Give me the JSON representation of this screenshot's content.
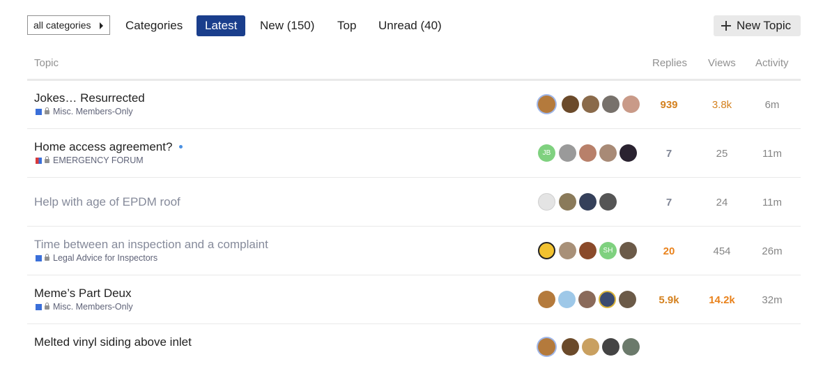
{
  "nav": {
    "category_dropdown": "all categories",
    "links": [
      "Categories",
      "Latest",
      "New (150)",
      "Top",
      "Unread (40)"
    ],
    "active": "Latest",
    "new_topic": "New Topic"
  },
  "columns": {
    "topic": "Topic",
    "replies": "Replies",
    "views": "Views",
    "activity": "Activity"
  },
  "colors": {
    "accent": "#1a3e8c",
    "hot": "#e07b20",
    "muted": "#858a9a"
  },
  "topics": [
    {
      "title": "Jokes… Resurrected",
      "category": "Misc. Members-Only",
      "replies": "939",
      "views": "3.8k",
      "activity": "6m"
    },
    {
      "title": "Home access agreement?",
      "category": "EMERGENCY FORUM",
      "replies": "7",
      "views": "25",
      "activity": "11m",
      "avatar_initials": "JB"
    },
    {
      "title": "Help with age of EPDM roof",
      "category": "",
      "replies": "7",
      "views": "24",
      "activity": "11m"
    },
    {
      "title": "Time between an inspection and a complaint",
      "category": "Legal Advice for Inspectors",
      "replies": "20",
      "views": "454",
      "activity": "26m",
      "avatar_initials": "SH"
    },
    {
      "title": "Meme’s Part Deux",
      "category": "Misc. Members-Only",
      "replies": "5.9k",
      "views": "14.2k",
      "activity": "32m"
    },
    {
      "title": "Melted vinyl siding above inlet",
      "category": "",
      "replies": "",
      "views": "",
      "activity": ""
    }
  ]
}
